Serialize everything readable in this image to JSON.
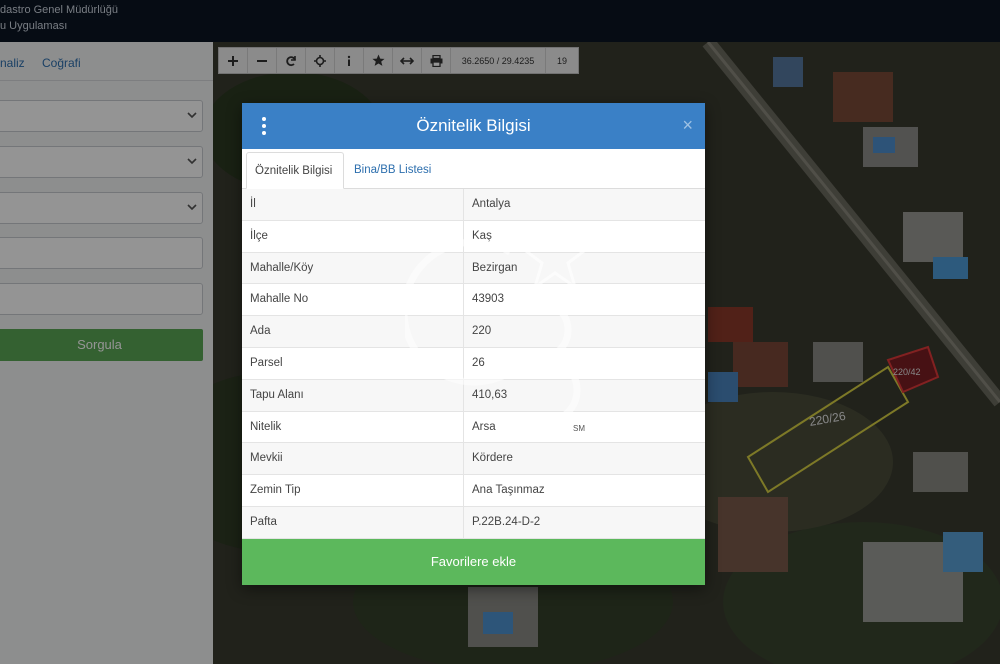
{
  "header": {
    "line1": "dastro Genel Müdürlüğü",
    "line2": "u Uygulaması"
  },
  "left_panel": {
    "tabs": [
      "naliz",
      "Coğrafi"
    ],
    "query_button": "Sorgula"
  },
  "toolbar": {
    "buttons": [
      "zoom-in",
      "zoom-out",
      "refresh",
      "locate",
      "info",
      "favorites",
      "measure",
      "print"
    ],
    "coordinates": "36.2650 / 29.4235",
    "zoom_level": "19"
  },
  "map": {
    "parcel_labels": [
      "220/26",
      "220/42"
    ]
  },
  "modal": {
    "title": "Öznitelik Bilgisi",
    "tabs": [
      "Öznitelik Bilgisi",
      "Bina/BB Listesi"
    ],
    "rows": [
      {
        "key": "İl",
        "value": "Antalya"
      },
      {
        "key": "İlçe",
        "value": "Kaş"
      },
      {
        "key": "Mahalle/Köy",
        "value": "Bezirgan"
      },
      {
        "key": "Mahalle No",
        "value": "43903"
      },
      {
        "key": "Ada",
        "value": "220"
      },
      {
        "key": "Parsel",
        "value": "26"
      },
      {
        "key": "Tapu Alanı",
        "value": "410,63"
      },
      {
        "key": "Nitelik",
        "value": "Arsa"
      },
      {
        "key": "Mevkii",
        "value": "Kördere"
      },
      {
        "key": "Zemin Tip",
        "value": "Ana Taşınmaz"
      },
      {
        "key": "Pafta",
        "value": "P.22B.24-D-2"
      }
    ],
    "favorite_button": "Favorilere ekle"
  },
  "watermark": {
    "badge": "SM"
  },
  "colors": {
    "header_bg": "#0b1523",
    "modal_header": "#3a80c6",
    "favorite_button": "#5cb85c",
    "query_button": "#5aa755",
    "link": "#2d6fae"
  }
}
